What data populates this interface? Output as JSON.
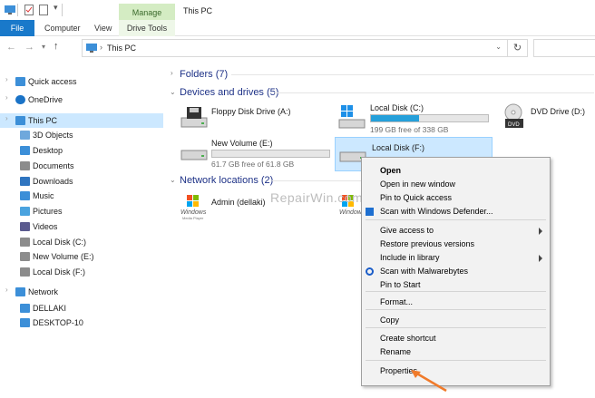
{
  "titlebar": {
    "title": "This PC",
    "manage_tab": "Manage",
    "drive_tools_tab": "Drive Tools"
  },
  "ribbon": {
    "tabs": [
      "File",
      "Computer",
      "View"
    ]
  },
  "address": {
    "path": "This PC"
  },
  "nav": {
    "items": [
      {
        "label": "Quick access",
        "icon": "star-icon"
      },
      {
        "label": "OneDrive",
        "icon": "cloud-icon"
      },
      {
        "label": "This PC",
        "icon": "computer-icon"
      },
      {
        "label": "3D Objects",
        "icon": "cube-icon"
      },
      {
        "label": "Desktop",
        "icon": "desktop-icon"
      },
      {
        "label": "Documents",
        "icon": "document-icon"
      },
      {
        "label": "Downloads",
        "icon": "download-icon"
      },
      {
        "label": "Music",
        "icon": "music-icon"
      },
      {
        "label": "Pictures",
        "icon": "picture-icon"
      },
      {
        "label": "Videos",
        "icon": "video-icon"
      },
      {
        "label": "Local Disk (C:)",
        "icon": "drive-icon"
      },
      {
        "label": "New Volume (E:)",
        "icon": "drive-icon"
      },
      {
        "label": "Local Disk (F:)",
        "icon": "drive-icon"
      },
      {
        "label": "Network",
        "icon": "network-icon"
      },
      {
        "label": "DELLAKI",
        "icon": "computer-icon"
      },
      {
        "label": "DESKTOP-10",
        "icon": "computer-icon"
      }
    ]
  },
  "sections": {
    "folders": "Folders (7)",
    "devices": "Devices and drives (5)",
    "network": "Network locations (2)"
  },
  "drives": {
    "floppy": {
      "name": "Floppy Disk Drive (A:)"
    },
    "c": {
      "name": "Local Disk (C:)",
      "free": "199 GB free of 338 GB",
      "used_fraction": 0.41
    },
    "dvd": {
      "name": "DVD Drive (D:)"
    },
    "e": {
      "name": "New Volume (E:)",
      "free": "61.7 GB free of 61.8 GB",
      "used_fraction": 0.0
    },
    "f": {
      "name": "Local Disk (F:)"
    }
  },
  "network_locations": {
    "admin": {
      "name": "Admin (dellaki)",
      "logo": "Windows",
      "logo_sub": "Media Player"
    }
  },
  "watermark": "RepairWin.com",
  "context_menu": {
    "items": [
      {
        "label": "Open",
        "bold": true
      },
      {
        "label": "Open in new window"
      },
      {
        "label": "Pin to Quick access"
      },
      {
        "label": "Scan with Windows Defender...",
        "icon": "defender-icon"
      },
      {
        "label": "Give access to",
        "submenu": true
      },
      {
        "label": "Restore previous versions"
      },
      {
        "label": "Include in library",
        "submenu": true
      },
      {
        "label": "Scan with Malwarebytes",
        "icon": "malwarebytes-icon"
      },
      {
        "label": "Pin to Start"
      },
      {
        "label": "Format..."
      },
      {
        "label": "Copy"
      },
      {
        "label": "Create shortcut"
      },
      {
        "label": "Rename"
      },
      {
        "label": "Properties"
      }
    ]
  },
  "colors": {
    "accent": "#1979ca",
    "selection": "#cce8ff",
    "arrow": "#f07a2a",
    "bar": "#26a0da"
  }
}
